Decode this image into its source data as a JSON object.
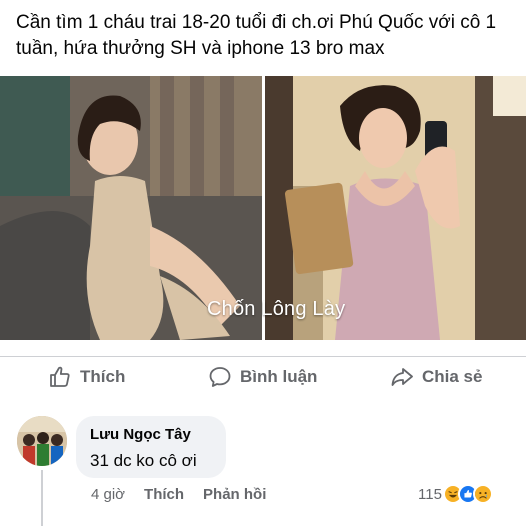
{
  "post": {
    "caption": "Cần tìm 1 cháu trai 18-20 tuổi đi ch.ơi Phú Quốc với cô 1 tuần, hứa thưởng SH và iphone 13 bro max",
    "watermark": "Chốn Lông Lày"
  },
  "actions": {
    "like_label": "Thích",
    "comment_label": "Bình luận",
    "share_label": "Chia sẻ"
  },
  "comment": {
    "author": "Lưu Ngọc Tây",
    "text": "31 dc ko cô ơi",
    "time": "4 giờ",
    "like_label": "Thích",
    "reply_label": "Phản hồi",
    "reaction_count": "115",
    "reactions": [
      "haha-icon",
      "like-icon",
      "sad-icon"
    ]
  },
  "colors": {
    "secondary_text": "#65676b",
    "bubble": "#f0f2f5",
    "like_blue": "#1877f2",
    "haha_yellow": "#f7b125"
  }
}
